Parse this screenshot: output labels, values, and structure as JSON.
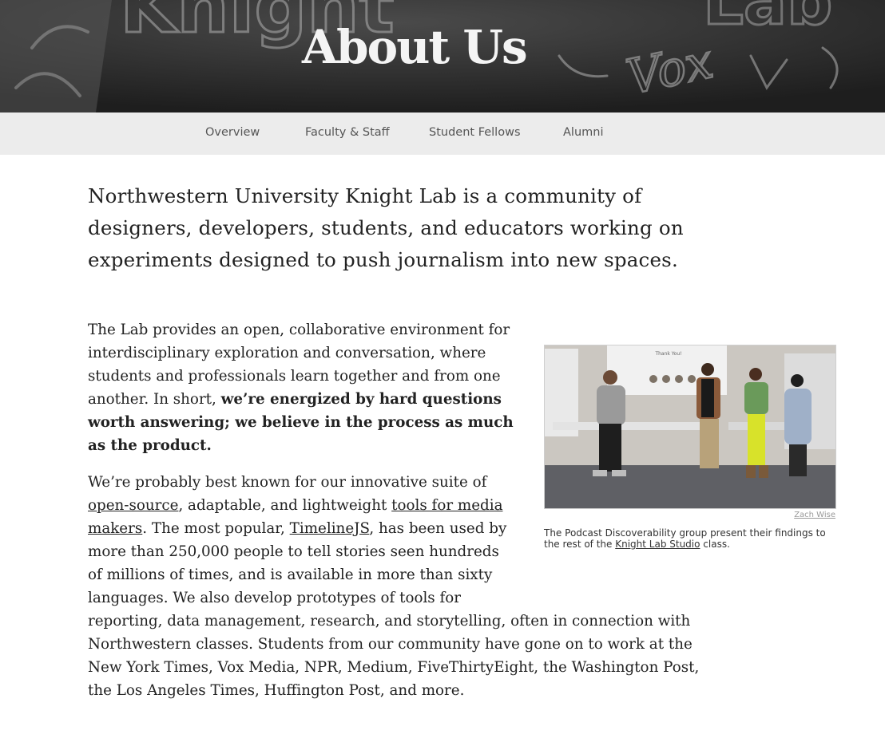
{
  "hero": {
    "title": "About Us",
    "chalk_text": [
      "Knight",
      "Lab",
      "Vox"
    ]
  },
  "subnav": {
    "items": [
      {
        "label": "Overview"
      },
      {
        "label": "Faculty & Staff"
      },
      {
        "label": "Student Fellows"
      },
      {
        "label": "Alumni"
      }
    ]
  },
  "content": {
    "lede": "Northwestern University Knight Lab is a community of designers, developers, students, and educators working on experiments designed to push journalism into new spaces.",
    "p1": {
      "text": "The Lab provides an open, collaborative environment for interdisciplinary exploration and conversation, where students and professionals learn together and from one another. In short, ",
      "bold": "we’re energized by hard questions worth answering; we believe in the process as much as the product."
    },
    "p2": {
      "t1": "We’re probably best known for our innovative suite of ",
      "link1": "open-source",
      "t2": ", adaptable, and lightweight ",
      "link2": "tools for media makers",
      "t3": ". The most popular, ",
      "link3": "TimelineJS",
      "t4": ", has been used by more than 250,000 people to tell stories seen hundreds of millions of times, and is available in more than sixty languages. We also develop prototypes of tools for reporting, data management, research, and storytelling, often in connection with Northwestern classes. Students from our community have gone on to work at the New York Times, Vox Media, NPR, Medium, FiveThirtyEight, the Washington Post, the Los Angeles Times, Huffington Post, and more."
    }
  },
  "figure": {
    "credit": "Zach Wise",
    "caption_pre": "The Podcast Discoverability group present their findings to the rest of the ",
    "caption_link": "Knight Lab Studio",
    "caption_post": " class.",
    "slide_title": "Thank You!"
  },
  "colors": {
    "hero_bg": "#2a2a2a",
    "subnav_bg": "#ececec",
    "text": "#222222"
  }
}
